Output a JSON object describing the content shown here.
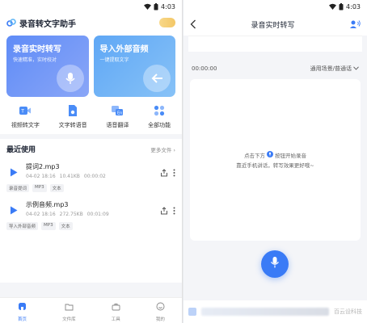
{
  "left": {
    "status": {
      "time": "4:03"
    },
    "app_title": "录音转文字助手",
    "cards": [
      {
        "title": "录音实时转写",
        "subtitle": "快速精准，实时校对"
      },
      {
        "title": "导入外部音频",
        "subtitle": "一键提取文字"
      }
    ],
    "tools": [
      {
        "label": "视频转文字",
        "icon": "video-to-text-icon"
      },
      {
        "label": "文字转语音",
        "icon": "text-to-speech-icon"
      },
      {
        "label": "语音翻译",
        "icon": "voice-translate-icon"
      },
      {
        "label": "全部功能",
        "icon": "all-features-icon"
      }
    ],
    "recent": {
      "title": "最近使用",
      "more": "更多文件",
      "files": [
        {
          "name": "提词2.mp3",
          "date": "04-02 18:16",
          "size": "10.41KB",
          "duration": "00:00:02",
          "tags": [
            "录音提词",
            "MP3",
            "文本"
          ]
        },
        {
          "name": "示例音频.mp3",
          "date": "04-02 18:16",
          "size": "272.75KB",
          "duration": "00:01:09",
          "tags": [
            "导入外部音频",
            "MP3",
            "文本"
          ]
        }
      ]
    },
    "nav": [
      {
        "label": "首页",
        "icon": "home-icon",
        "active": true
      },
      {
        "label": "文件库",
        "icon": "folder-icon"
      },
      {
        "label": "工具",
        "icon": "toolbox-icon"
      },
      {
        "label": "我的",
        "icon": "profile-icon"
      }
    ]
  },
  "right": {
    "status": {
      "time": "4:03"
    },
    "title": "录音实时转写",
    "timer": "00:00:00",
    "scene": "通用场景/普通话",
    "hint_line1_pre": "点击下方",
    "hint_line1_post": "按钮开始录音",
    "hint_line2": "靠近手机讲话，转写效果更好哦~",
    "watermark": "百云设科技"
  },
  "colors": {
    "accent": "#3a7bf6",
    "card_record": "#6a93f7",
    "card_import": "#6aaef5"
  }
}
